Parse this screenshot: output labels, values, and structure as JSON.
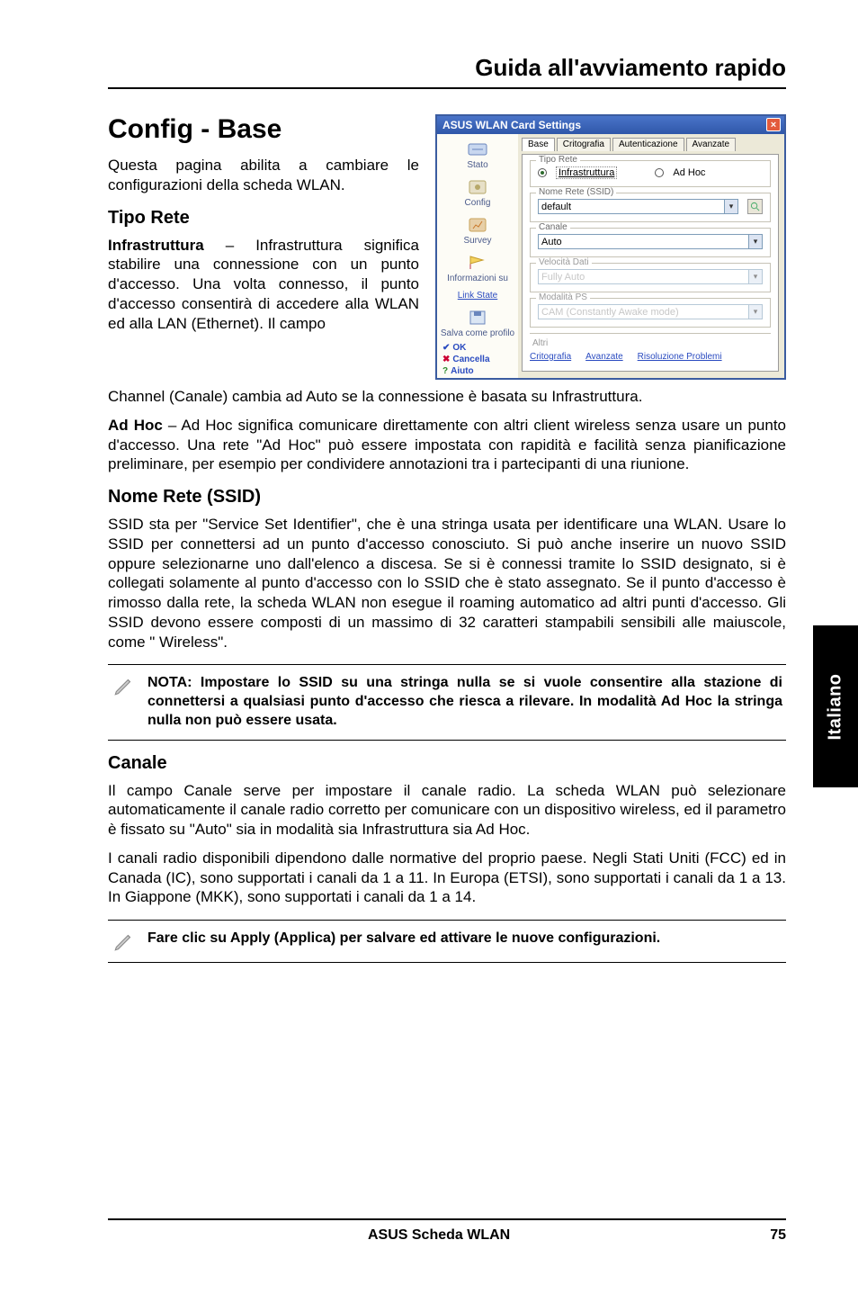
{
  "page": {
    "header_title": "Guida all'avviamento rapido",
    "section_title": "Config - Base",
    "intro": "Questa pagina abilita a cambiare le configurazioni della scheda WLAN.",
    "tipo_rete_heading": "Tipo Rete",
    "infra_label": "Infrastruttura",
    "infra_dash": " – ",
    "infra_text_1": "Infrastruttura significa stabilire una connessione con un punto d'accesso. Una volta connesso, il punto d'accesso consentirà di accedere alla WLAN ed alla LAN (Ethernet). Il campo",
    "channel_line": "Channel (Canale) cambia ad Auto se la connessione è basata su Infrastruttura.",
    "adhoc_label": "Ad Hoc",
    "adhoc_text": " – Ad Hoc significa comunicare direttamente con altri client wireless senza usare un punto d'accesso. Una rete \"Ad Hoc\" può essere impostata con rapidità e facilità senza pianificazione preliminare, per esempio per condividere annotazioni tra i partecipanti di una riunione.",
    "ssid_heading": "Nome Rete  (SSID)",
    "ssid_text": "SSID sta per \"Service Set Identifier\", che è una stringa usata per identificare una WLAN. Usare lo SSID per connettersi ad un punto d'accesso conosciuto. Si può anche inserire un nuovo SSID oppure selezionarne uno dall'elenco a discesa. Se si è connessi tramite lo SSID designato, si è collegati solamente al punto d'accesso con lo SSID che è stato assegnato. Se il punto d'accesso è rimosso dalla rete, la scheda WLAN non esegue il roaming automatico ad altri punti d'accesso. Gli SSID devono essere composti di un massimo di 32 caratteri stampabili sensibili alle maiuscole, come \" Wireless\".",
    "note1": "NOTA: Impostare lo SSID su una stringa nulla se si vuole consentire alla stazione di connettersi a qualsiasi punto d'accesso che riesca a rilevare. In modalità Ad Hoc la stringa nulla non può essere usata.",
    "canale_heading": "Canale",
    "canale_p1": "Il campo Canale serve per impostare il canale radio. La scheda WLAN può selezionare automaticamente il canale radio corretto per comunicare con un dispositivo wireless, ed il parametro è fissato su \"Auto\" sia in modalità sia Infrastruttura sia Ad Hoc.",
    "canale_p2": "I canali radio disponibili dipendono dalle normative del proprio paese. Negli Stati Uniti (FCC) ed in Canada (IC), sono supportati i canali da 1 a 11. In Europa (ETSI), sono supportati i canali da 1 a 13. In Giappone (MKK), sono supportati i canali da 1 a 14.",
    "note2": "Fare clic su Apply (Applica) per salvare ed attivare le nuove configurazioni.",
    "footer_center": "ASUS Scheda WLAN",
    "footer_page": "75",
    "side_tab": "Italiano"
  },
  "screenshot": {
    "window_title": "ASUS WLAN Card Settings",
    "sidebar": {
      "stato": "Stato",
      "config": "Config",
      "survey": "Survey",
      "info": "Informazioni su",
      "link": "Link State",
      "save": "Salva come profilo",
      "ok": "OK",
      "cancel": "Cancella",
      "help": "Aiuto"
    },
    "tabs": {
      "base": "Base",
      "critografia": "Critografia",
      "autenticazione": "Autenticazione",
      "avanzate": "Avanzate"
    },
    "groups": {
      "tipo_rete": "Tipo Rete",
      "infrastruttura": "Infrastruttura",
      "adhoc": "Ad Hoc",
      "nome_rete": "Nome Rete (SSID)",
      "ssid_value": "default",
      "canale": "Canale",
      "canale_value": "Auto",
      "velocita": "Velocità Dati",
      "velocita_value": "Fully Auto",
      "modalita": "Modalità PS",
      "modalita_value": "CAM (Constantly Awake mode)",
      "altri": "Altri"
    },
    "buttons": {
      "critografia": "Critografia",
      "avanzate": "Avanzate",
      "problemi": "Risoluzione Problemi"
    }
  }
}
